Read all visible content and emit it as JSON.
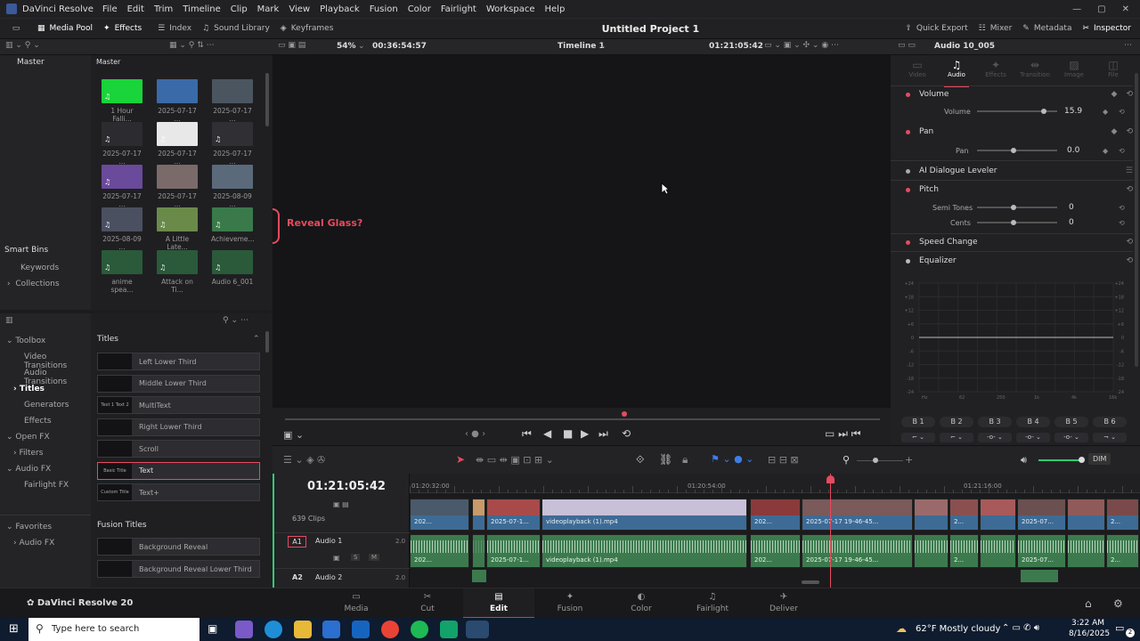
{
  "app": {
    "name": "DaVinci Resolve",
    "menu": [
      "File",
      "Edit",
      "Trim",
      "Timeline",
      "Clip",
      "Mark",
      "View",
      "Playback",
      "Fusion",
      "Color",
      "Fairlight",
      "Workspace",
      "Help"
    ],
    "project_title": "Untitled Project 1",
    "version_label": "DaVinci Resolve 20"
  },
  "toolbar": {
    "media_pool": "Media Pool",
    "effects": "Effects",
    "index": "Index",
    "sound_library": "Sound Library",
    "keyframes": "Keyframes",
    "quick_export": "Quick Export",
    "mixer": "Mixer",
    "metadata": "Metadata",
    "inspector": "Inspector"
  },
  "viewer_bar": {
    "zoom": "54%",
    "duration": "00:36:54:57",
    "timeline_name": "Timeline 1",
    "timecode": "01:21:05:42",
    "inspector_clip": "Audio 10_005"
  },
  "media_pool": {
    "master_label": "Master",
    "bin_header": "Master",
    "smart_bins": "Smart Bins",
    "keywords": "Keywords",
    "collections": "Collections",
    "clips": [
      {
        "label": "1 Hour Falli...",
        "color": "#19d43a"
      },
      {
        "label": "2025-07-17 ...",
        "color": "#3a6aa8"
      },
      {
        "label": "2025-07-17 ...",
        "color": "#4a5560"
      },
      {
        "label": "2025-07-17 ...",
        "color": "#2c2c30"
      },
      {
        "label": "2025-07-17 ...",
        "color": "#e8e8e8"
      },
      {
        "label": "2025-07-17 ...",
        "color": "#303034"
      },
      {
        "label": "2025-07-17 ...",
        "color": "#6a4a9a"
      },
      {
        "label": "2025-07-17 ...",
        "color": "#7a6a6a"
      },
      {
        "label": "2025-08-09 ...",
        "color": "#5a6a7a"
      },
      {
        "label": "2025-08-09 ...",
        "color": "#4a5060"
      },
      {
        "label": "A Little Late...",
        "color": "#6a8a4a"
      },
      {
        "label": "Achieveme...",
        "color": "#3a7a4a"
      },
      {
        "label": "anime spea...",
        "color": "#2a5a3a"
      },
      {
        "label": "Attack on Ti...",
        "color": "#2a5a3a"
      },
      {
        "label": "Audio 6_001",
        "color": "#2a5a3a"
      }
    ]
  },
  "viewer": {
    "overlay_text": "Reveal Glass?"
  },
  "effects_library": {
    "tree": [
      "Toolbox",
      "Video Transitions",
      "Audio Transitions",
      "Titles",
      "Generators",
      "Effects",
      "Open FX",
      "Filters",
      "Audio FX",
      "Fairlight FX",
      "Favorites",
      "Audio FX"
    ],
    "titles_header": "Titles",
    "titles": [
      {
        "thumb": "",
        "label": "Left Lower Third"
      },
      {
        "thumb": "",
        "label": "Middle Lower Third"
      },
      {
        "thumb": "Text 1 Text 2",
        "label": "MultiText"
      },
      {
        "thumb": "",
        "label": "Right Lower Third"
      },
      {
        "thumb": "",
        "label": "Scroll"
      },
      {
        "thumb": "Basic Title",
        "label": "Text"
      },
      {
        "thumb": "Custom Title",
        "label": "Text+"
      }
    ],
    "fusion_header": "Fusion Titles",
    "fusion_titles": [
      {
        "label": "Background Reveal"
      },
      {
        "label": "Background Reveal Lower Third"
      }
    ]
  },
  "inspector": {
    "tabs": [
      "Video",
      "Audio",
      "Effects",
      "Transition",
      "Image",
      "File"
    ],
    "volume_section": "Volume",
    "volume_label": "Volume",
    "volume_value": "15.9",
    "pan_section": "Pan",
    "pan_label": "Pan",
    "pan_value": "0.0",
    "ai_dialogue": "AI Dialogue Leveler",
    "pitch_section": "Pitch",
    "semitones_label": "Semi Tones",
    "semitones_value": "0",
    "cents_label": "Cents",
    "cents_value": "0",
    "speed_change": "Speed Change",
    "equalizer": "Equalizer",
    "eq_db_labels": [
      "+24",
      "+18",
      "+12",
      "+6",
      "0",
      "-6",
      "-12",
      "-18",
      "-24"
    ],
    "eq_freq_labels": [
      "Hz",
      "62",
      "250",
      "1k",
      "4k",
      "16k"
    ],
    "band_labels": [
      "B 1",
      "B 2",
      "B 3",
      "B 4",
      "B 5",
      "B 6"
    ]
  },
  "timeline": {
    "timecode": "01:21:05:42",
    "ruler": [
      "01:20:32:00",
      "01:20:54:00",
      "01:21:16:00"
    ],
    "clip_count": "639 Clips",
    "a1_tag": "A1",
    "a1_name": "Audio 1",
    "a1_level": "2.0",
    "a2_tag": "A2",
    "a2_name": "Audio 2",
    "a2_level": "2.0",
    "dim_label": "DIM",
    "s_label": "S",
    "m_label": "M",
    "video_clips": [
      "202...",
      "2025-07-1...",
      "videoplayback (1).mp4",
      "202...",
      "2025-07-17 19-46-45...",
      "2...",
      "2025-07...",
      "2..."
    ],
    "audio_clips": [
      "202...",
      "2025-07-1...",
      "videoplayback (1).mp4",
      "202...",
      "2025-07-17 19-46-45...",
      "2...",
      "2025-07...",
      "2..."
    ]
  },
  "pages": [
    "Media",
    "Cut",
    "Edit",
    "Fusion",
    "Color",
    "Fairlight",
    "Deliver"
  ],
  "taskbar": {
    "search_placeholder": "Type here to search",
    "weather": "62°F  Mostly cloudy",
    "time": "3:22 AM",
    "date": "8/16/2025",
    "notifications": "2"
  },
  "colors": {
    "accent_red": "#e64b5f",
    "edit_accent": "#d8364c",
    "audio_clip": "#3c7a4e",
    "video_clip": "#3d6b95"
  }
}
